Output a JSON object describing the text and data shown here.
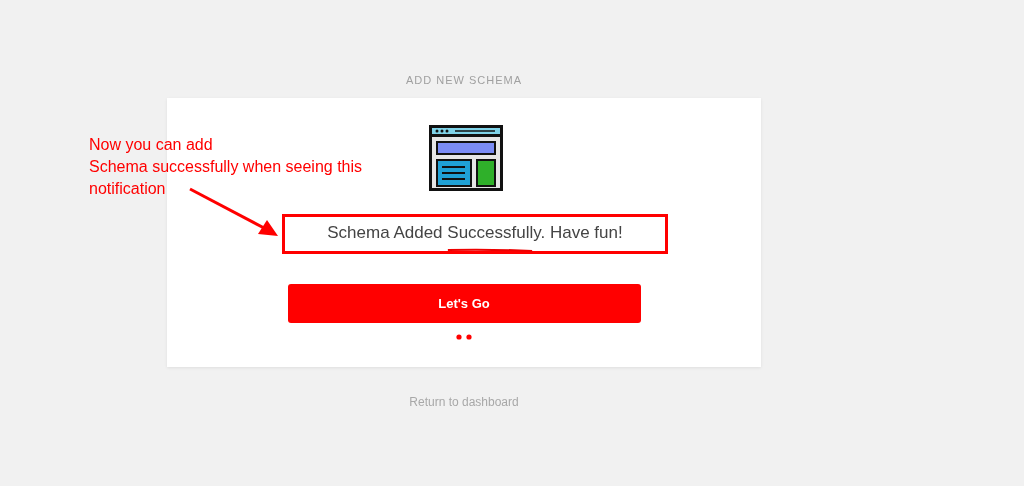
{
  "page_title": "ADD NEW SCHEMA",
  "card": {
    "message": "Schema Added Successfully. Have fun!",
    "button": "Let's Go"
  },
  "return_link": "Return to dashboard",
  "annotation": {
    "text": "Now you can add\nSchema successfully when seeing this\nnotification"
  }
}
